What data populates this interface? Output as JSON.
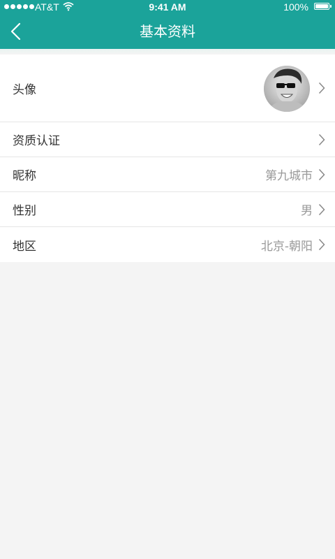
{
  "status_bar": {
    "carrier": "AT&T",
    "time": "9:41 AM",
    "battery": "100%"
  },
  "nav": {
    "title": "基本资料",
    "back_icon": "chevron-left-icon"
  },
  "colors": {
    "brand": "#1ba39a",
    "background": "#f4f4f4",
    "value_text": "#999999"
  },
  "profile": {
    "avatar_label": "头像",
    "qualification_label": "资质认证",
    "nickname_label": "昵称",
    "nickname_value": "第九城市",
    "gender_label": "性别",
    "gender_value": "男",
    "region_label": "地区",
    "region_value": "北京-朝阳"
  }
}
